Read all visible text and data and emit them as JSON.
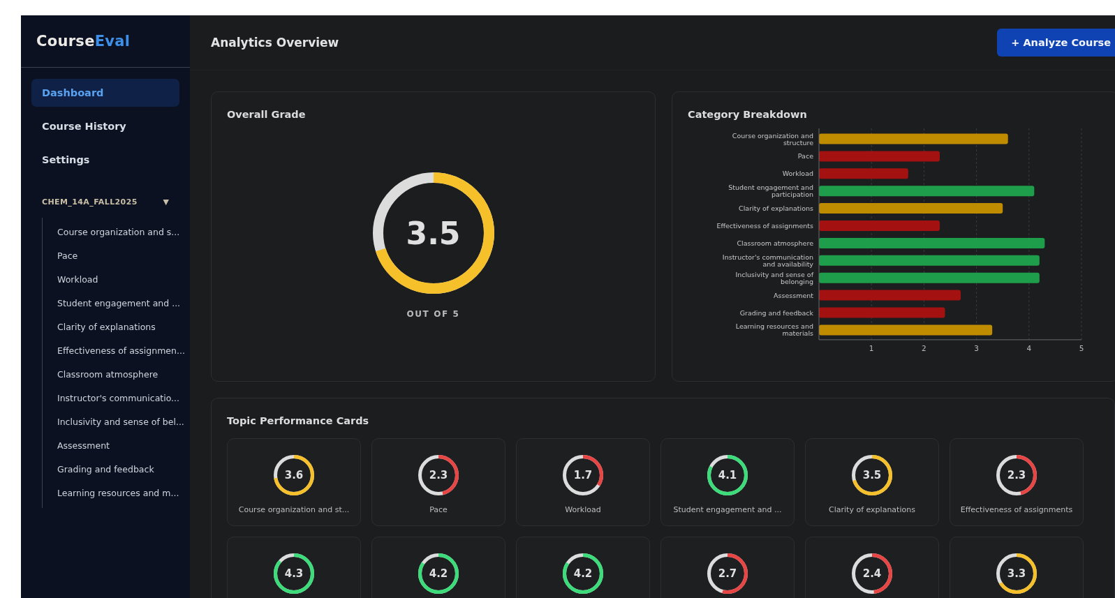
{
  "sidebar": {
    "logo": {
      "first": "Course",
      "second": "Eval"
    },
    "nav": [
      {
        "label": "Dashboard",
        "selected": true
      },
      {
        "label": "Course History",
        "selected": false
      },
      {
        "label": "Settings",
        "selected": false
      }
    ],
    "course": {
      "title": "CHEM_14A_FALL2025",
      "toggle": "▼",
      "expanded": true,
      "items": [
        "Course organization and s...",
        "Pace",
        "Workload",
        "Student engagement and ...",
        "Clarity of explanations",
        "Effectiveness of assignmen...",
        "Classroom atmosphere",
        "Instructor's communicatio...",
        "Inclusivity and sense of bel...",
        "Assessment",
        "Grading and feedback",
        "Learning resources and m..."
      ]
    }
  },
  "header": {
    "title": "Analytics Overview",
    "button": "+ Analyze Course"
  },
  "overall": {
    "title": "Overall Grade",
    "value": "3.5",
    "caption": "OUT OF 5",
    "color": "#f5c02a"
  },
  "breakdown": {
    "title": "Category Breakdown",
    "chart_data": {
      "type": "bar",
      "orientation": "horizontal",
      "categories": [
        "Course organization and structure",
        "Pace",
        "Workload",
        "Student engagement and participation",
        "Clarity of explanations",
        "Effectiveness of assignments",
        "Classroom atmosphere",
        "Instructor's communication and availability",
        "Inclusivity and sense of belonging",
        "Assessment",
        "Grading and feedback",
        "Learning resources and materials"
      ],
      "values": [
        3.6,
        2.3,
        1.7,
        4.1,
        3.5,
        2.3,
        4.3,
        4.2,
        4.2,
        2.7,
        2.4,
        3.3
      ],
      "xlim": [
        0,
        5
      ],
      "xticks": [
        1,
        2,
        3,
        4,
        5
      ],
      "grid": true
    }
  },
  "topics": {
    "title": "Topic Performance Cards",
    "cards": [
      {
        "value": "3.6",
        "color": "#f5c02a",
        "label": "Course organization and st..."
      },
      {
        "value": "2.3",
        "color": "#e84545",
        "label": "Pace"
      },
      {
        "value": "1.7",
        "color": "#e84545",
        "label": "Workload"
      },
      {
        "value": "4.1",
        "color": "#3ddc7a",
        "label": "Student engagement and ..."
      },
      {
        "value": "3.5",
        "color": "#f5c02a",
        "label": "Clarity of explanations"
      },
      {
        "value": "2.3",
        "color": "#e84545",
        "label": "Effectiveness of assignments"
      },
      {
        "value": "4.3",
        "color": "#3ddc7a"
      },
      {
        "value": "4.2",
        "color": "#3ddc7a"
      },
      {
        "value": "4.2",
        "color": "#3ddc7a"
      },
      {
        "value": "2.7",
        "color": "#e84545"
      },
      {
        "value": "2.4",
        "color": "#e84545"
      },
      {
        "value": "3.3",
        "color": "#f5c02a"
      }
    ]
  }
}
